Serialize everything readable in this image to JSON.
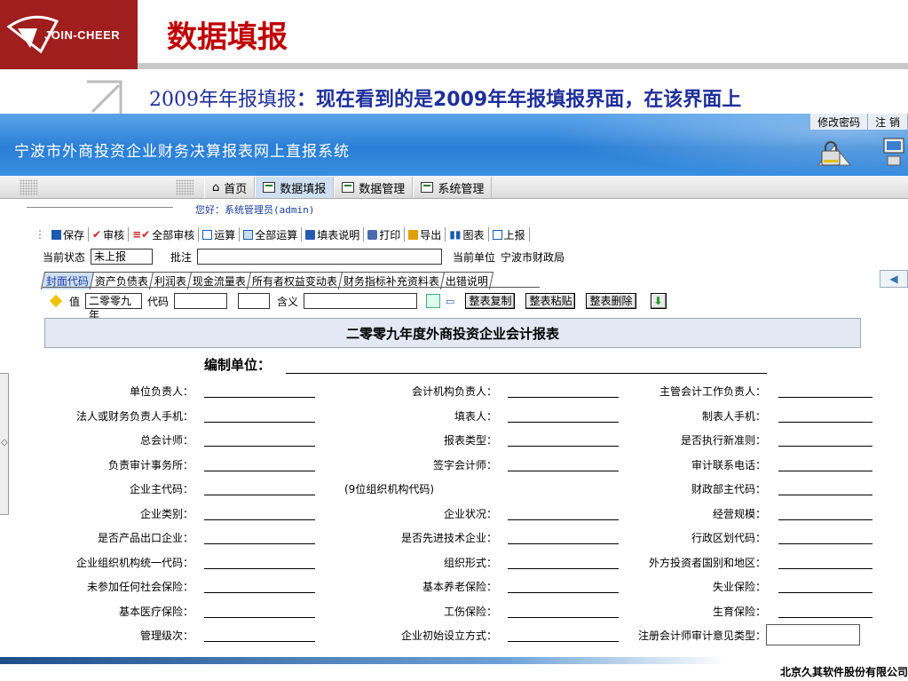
{
  "slide": {
    "logo_text": "JOIN-CHEER",
    "title": "数据填报",
    "subtitle_part1": "2009年年报填报",
    "subtitle_part2": "：现在看到的是2009年年报填报界面，在该界面上",
    "footer": "北京久其软件股份有限公司"
  },
  "app": {
    "title": "宁波市外商投资企业财务决算报表网上直报系统",
    "top_links": [
      "修改密码",
      "注 销"
    ],
    "menu": [
      {
        "label": "首页",
        "icon": "home-icon"
      },
      {
        "label": "数据填报",
        "icon": "form-icon",
        "active": true
      },
      {
        "label": "数据管理",
        "icon": "form-icon"
      },
      {
        "label": "系统管理",
        "icon": "form-icon"
      }
    ],
    "welcome": "您好：系统管理员(admin)"
  },
  "toolbar": [
    {
      "label": "保存",
      "icon": "save-icon",
      "color": "#1a5ab0"
    },
    {
      "label": "审核",
      "icon": "check-icon",
      "color": "#d02020"
    },
    {
      "label": "全部审核",
      "icon": "check-all-icon",
      "color": "#d02020"
    },
    {
      "label": "运算",
      "icon": "calc-icon",
      "color": "#1a5ab0"
    },
    {
      "label": "全部运算",
      "icon": "calc-all-icon",
      "color": "#1a5ab0"
    },
    {
      "label": "填表说明",
      "icon": "book-icon",
      "color": "#1a5ab0"
    },
    {
      "label": "打印",
      "icon": "print-icon",
      "color": "#1a5ab0"
    },
    {
      "label": "导出",
      "icon": "export-icon",
      "color": "#e0a000"
    },
    {
      "label": "图表",
      "icon": "chart-icon",
      "color": "#1a5ab0"
    },
    {
      "label": "上报",
      "icon": "upload-icon",
      "color": "#1a5ab0"
    }
  ],
  "status": {
    "state_label": "当前状态",
    "state_value": "未上报",
    "note_label": "批注",
    "note_value": "",
    "unit_label": "当前单位",
    "unit_value": "宁波市财政局"
  },
  "tabs": [
    "封面代码",
    "资产负债表",
    "利润表",
    "现金流量表",
    "所有者权益变动表",
    "财务指标补充资料表",
    "出错说明"
  ],
  "value_row": {
    "value_label": "值",
    "value_input": "二零零九年",
    "code_label": "代码",
    "meaning_label": "含义",
    "buttons": [
      "整表复制",
      "整表粘贴",
      "整表删除"
    ]
  },
  "form": {
    "title": "二零零九年度外商投资企业会计报表",
    "unit_label": "编制单位：",
    "rows": [
      [
        "单位负责人：",
        "会计机构负责人：",
        "主管会计工作负责人："
      ],
      [
        "法人或财务负责人手机：",
        "填表人：",
        "制表人手机："
      ],
      [
        "总会计师：",
        "报表类型：",
        "是否执行新准则："
      ],
      [
        "负责审计事务所：",
        "签字会计师：",
        "审计联系电话："
      ],
      [
        "企业主代码：",
        "",
        "财政部主代码："
      ],
      [
        "企业类别：",
        "企业状况：",
        "经营规模："
      ],
      [
        "是否产品出口企业：",
        "是否先进技术企业：",
        "行政区划代码："
      ],
      [
        "企业组织机构统一代码：",
        "组织形式：",
        "外方投资者国别和地区："
      ],
      [
        "未参加任何社会保险：",
        "基本养老保险：",
        "失业保险："
      ],
      [
        "基本医疗保险：",
        "工伤保险：",
        "生育保险："
      ],
      [
        "管理级次：",
        "企业初始设立方式：",
        "注册会计师审计意见类型："
      ]
    ],
    "org_code_note": "(9位组织机构代码)"
  }
}
